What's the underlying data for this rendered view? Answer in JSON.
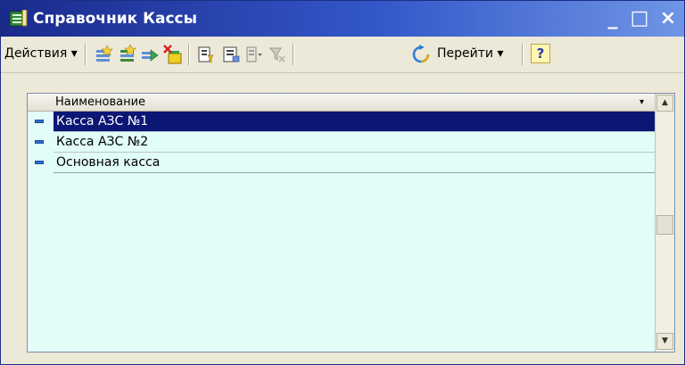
{
  "window": {
    "title": "Справочник Кассы",
    "controls": {
      "minimize": "_",
      "maximize": "□",
      "close": "×"
    }
  },
  "toolbar": {
    "actions_label": "Действия ▾",
    "goto_label": "Перейти ▾",
    "help_label": "?",
    "icons": [
      "add-icon",
      "add-group-icon",
      "copy-icon",
      "delete-icon",
      "filter-icon",
      "filter-settings-icon",
      "sort-icon",
      "clear-filter-icon",
      "refresh-icon"
    ]
  },
  "table": {
    "column_header": "Наименование",
    "column_header_arrow": "▾",
    "rows": [
      {
        "name": "Касса АЗС №1",
        "selected": true
      },
      {
        "name": "Касса АЗС №2",
        "selected": false
      },
      {
        "name": "Основная касса",
        "selected": false
      }
    ],
    "scroll_up": "▲",
    "scroll_down": "▼"
  },
  "colors": {
    "titlebar": "#1a2a8c",
    "selection": "#0c1675",
    "table_background": "#e2fcf8",
    "row_marker": "#2b6fcf"
  }
}
